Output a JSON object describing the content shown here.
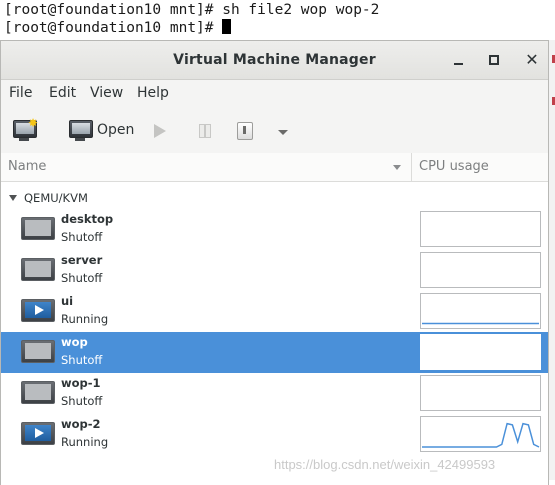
{
  "terminal": {
    "lines": [
      "[root@foundation10 mnt]# sh file2 wop wop-2",
      "[root@foundation10 mnt]# "
    ]
  },
  "window": {
    "title": "Virtual Machine Manager"
  },
  "menubar": {
    "items": [
      "File",
      "Edit",
      "View",
      "Help"
    ]
  },
  "toolbar": {
    "open_label": "Open"
  },
  "list": {
    "columns": {
      "name": "Name",
      "cpu": "CPU usage"
    },
    "group": "QEMU/KVM",
    "vms": [
      {
        "name": "desktop",
        "status": "Shutoff",
        "running": false,
        "selected": false,
        "cpu_trace": []
      },
      {
        "name": "server",
        "status": "Shutoff",
        "running": false,
        "selected": false,
        "cpu_trace": []
      },
      {
        "name": "ui",
        "status": "Running",
        "running": true,
        "selected": false,
        "cpu_trace": [
          0.02,
          0.02,
          0.02,
          0.02,
          0.02,
          0.02,
          0.02,
          0.02,
          0.02,
          0.02,
          0.02,
          0.02,
          0.02,
          0.02,
          0.02,
          0.02,
          0.02,
          0.02,
          0.02,
          0.02
        ]
      },
      {
        "name": "wop",
        "status": "Shutoff",
        "running": false,
        "selected": true,
        "cpu_trace": []
      },
      {
        "name": "wop-1",
        "status": "Shutoff",
        "running": false,
        "selected": false,
        "cpu_trace": []
      },
      {
        "name": "wop-2",
        "status": "Running",
        "running": true,
        "selected": false,
        "cpu_trace": [
          0,
          0,
          0,
          0,
          0,
          0,
          0,
          0,
          0,
          0,
          0,
          0,
          0,
          0,
          0,
          0.1,
          0.9,
          0.85,
          0.2,
          0.9,
          0.85,
          0.1,
          0
        ]
      }
    ]
  },
  "watermark": "https://blog.csdn.net/weixin_42499593",
  "colors": {
    "selection": "#4a90d9",
    "cpu_line": "#4a90d9"
  }
}
